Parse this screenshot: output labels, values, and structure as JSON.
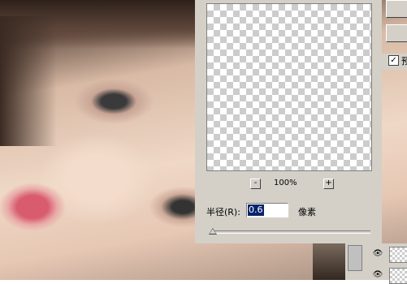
{
  "photo": {
    "icon": "portrait-photo"
  },
  "dialog": {
    "zoom": {
      "out_label": "-",
      "in_label": "+",
      "value": "100%"
    },
    "radius": {
      "label": "半径(R):",
      "value": "0.6",
      "unit": "像素"
    },
    "slider": {
      "level": 0.01
    }
  },
  "right_panel": {
    "preview_checkbox": {
      "checked": true,
      "mark": "✓",
      "label": "预"
    }
  },
  "layers_panel": {
    "eye_glyph": "👁"
  }
}
